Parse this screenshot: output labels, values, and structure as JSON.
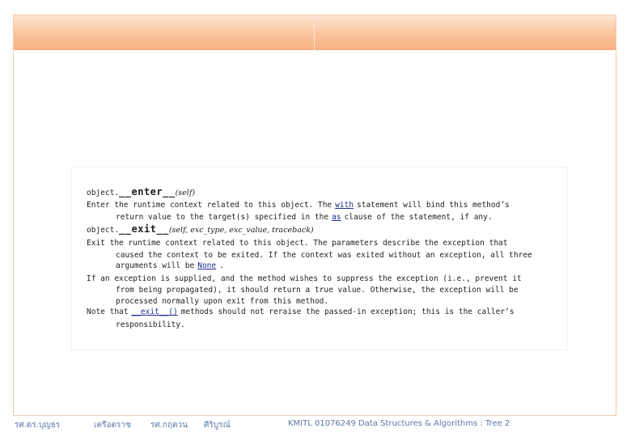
{
  "doc": {
    "enter_sig_prefix": "object.",
    "enter_name": "__enter__",
    "enter_args": "(self)",
    "enter_desc_1a": "Enter the runtime context related to this object. The",
    "enter_kw_with": "with",
    "enter_desc_1b": "statement will bind this method’s",
    "enter_desc_2a": "return value to the target(s) specified in the",
    "enter_kw_as": "as",
    "enter_desc_2b": "clause of the statement, if any.",
    "exit_sig_prefix": "object.",
    "exit_name": "__exit__",
    "exit_args": "(self, exc_type, exc_value, traceback)",
    "exit_desc_1": "Exit the runtime context related to this object. The parameters describe the exception that",
    "exit_desc_2": "caused the context to be exited. If the context was exited without an exception, all three",
    "exit_desc_3a": "arguments will be",
    "exit_kw_none": "None",
    "exit_desc_3b": ".",
    "exit_desc_4": "If an exception is supplied, and the method wishes to suppress the exception (i.e., prevent it",
    "exit_desc_5": "from being propagated), it should return a true value. Otherwise, the exception will be",
    "exit_desc_6": "processed normally upon exit from this method.",
    "note_a": "Note that",
    "note_kw": "__exit__()",
    "note_b": "methods should not reraise the passed-in exception; this is the caller’s",
    "note_c": "responsibility."
  },
  "footer": {
    "author_1": "รศ.ดร.บุญธร",
    "author_2": "เครือตราช",
    "author_3": "รศ.กฤตวน",
    "author_4": "ศิริบูรณ์",
    "course": "KMITL   01076249 Data Structures & Algorithms : Tree 2"
  }
}
